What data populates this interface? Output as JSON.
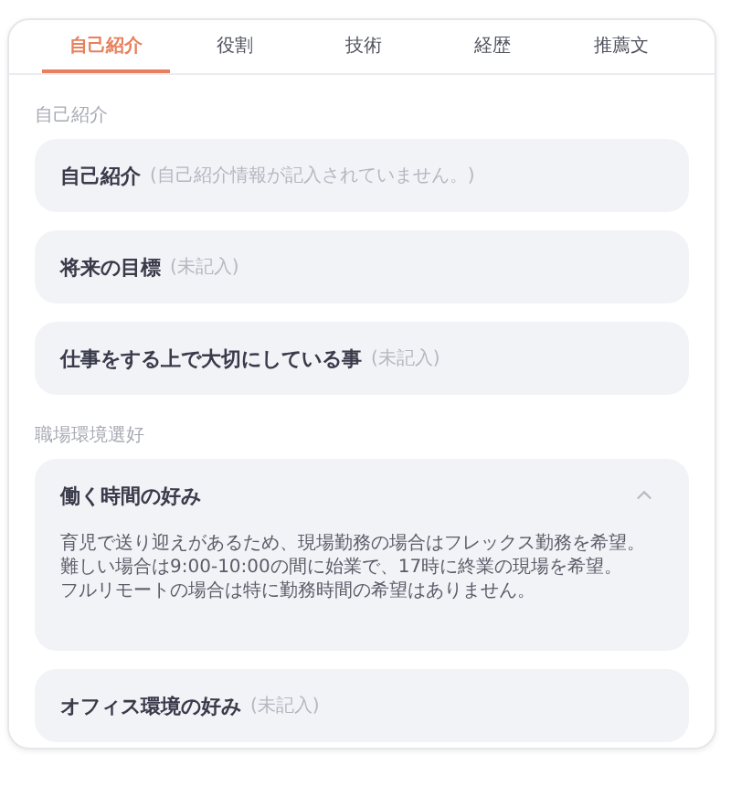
{
  "tabs": [
    {
      "label": "自己紹介",
      "selected": true
    },
    {
      "label": "役割",
      "selected": false
    },
    {
      "label": "技術",
      "selected": false
    },
    {
      "label": "経歴",
      "selected": false
    },
    {
      "label": "推薦文",
      "selected": false
    }
  ],
  "sections": [
    {
      "heading": "自己紹介",
      "items": [
        {
          "title": "自己紹介",
          "note": "(自己紹介情報が記入されていません。)",
          "expanded": false
        },
        {
          "title": "将来の目標",
          "note": "(未記入)",
          "expanded": false
        },
        {
          "title": "仕事をする上で大切にしている事",
          "note": "(未記入)",
          "expanded": false
        }
      ]
    },
    {
      "heading": "職場環境選好",
      "items": [
        {
          "title": "働く時間の好み",
          "expanded": true,
          "body": [
            "育児で送り迎えがあるため、現場勤務の場合はフレックス勤務を希望。",
            "難しい場合は9:00-10:00の間に始業で、17時に終業の現場を希望。",
            "フルリモートの場合は特に勤務時間の希望はありません。"
          ]
        },
        {
          "title": "オフィス環境の好み",
          "note": "(未記入)",
          "expanded": false
        }
      ]
    }
  ]
}
